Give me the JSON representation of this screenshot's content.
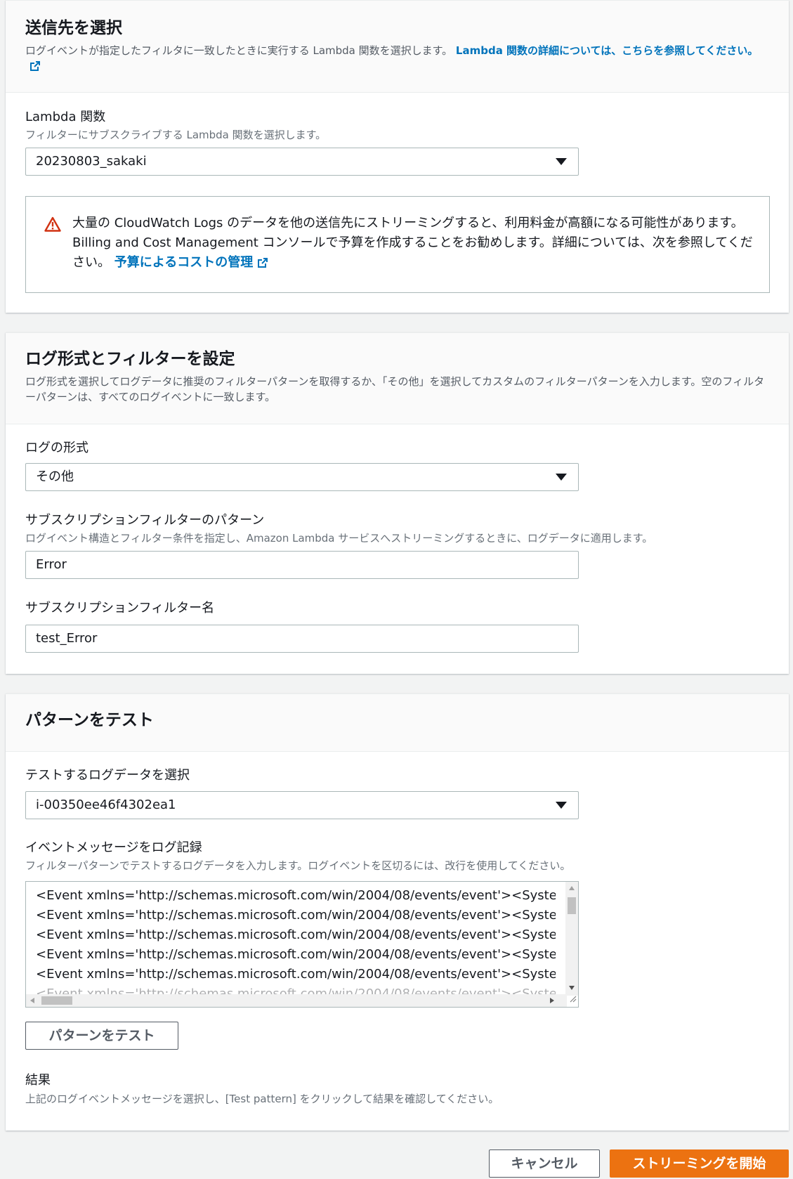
{
  "destination": {
    "title": "送信先を選択",
    "desc": "ログイベントが指定したフィルタに一致したときに実行する Lambda 関数を選択します。",
    "link": "Lambda 関数の詳細については、こちらを参照してください。",
    "lambda_label": "Lambda 関数",
    "lambda_desc": "フィルターにサブスクライブする Lambda 関数を選択します。",
    "lambda_value": "20230803_sakaki",
    "alert_text": "大量の CloudWatch Logs のデータを他の送信先にストリーミングすると、利用料金が高額になる可能性があります。Billing and Cost Management コンソールで予算を作成することをお勧めします。詳細については、次を参照してください。",
    "alert_link": "予算によるコストの管理"
  },
  "filter": {
    "title": "ログ形式とフィルターを設定",
    "desc": "ログ形式を選択してログデータに推奨のフィルターパターンを取得するか、「その他」を選択してカスタムのフィルターパターンを入力します。空のフィルターパターンは、すべてのログイベントに一致します。",
    "format_label": "ログの形式",
    "format_value": "その他",
    "pattern_label": "サブスクリプションフィルターのパターン",
    "pattern_desc": "ログイベント構造とフィルター条件を指定し、Amazon Lambda サービスへストリーミングするときに、ログデータに適用します。",
    "pattern_value": "Error",
    "name_label": "サブスクリプションフィルター名",
    "name_value": "test_Error"
  },
  "test": {
    "title": "パターンをテスト",
    "logdata_label": "テストするログデータを選択",
    "logdata_value": "i-00350ee46f4302ea1",
    "events_label": "イベントメッセージをログ記録",
    "events_desc": "フィルターパターンでテストするログデータを入力します。ログイベントを区切るには、改行を使用してください。",
    "event_lines": [
      "<Event xmlns='http://schemas.microsoft.com/win/2004/08/events/event'><System>",
      "<Event xmlns='http://schemas.microsoft.com/win/2004/08/events/event'><System>",
      "<Event xmlns='http://schemas.microsoft.com/win/2004/08/events/event'><System>",
      "<Event xmlns='http://schemas.microsoft.com/win/2004/08/events/event'><System>",
      "<Event xmlns='http://schemas.microsoft.com/win/2004/08/events/event'><System>",
      "<Event xmlns='http://schemas.microsoft.com/win/2004/08/events/event'><System>"
    ],
    "test_button": "パターンをテスト",
    "result_label": "結果",
    "result_desc": "上記のログイベントメッセージを選択し、[Test pattern] をクリックして結果を確認してください。"
  },
  "footer": {
    "cancel": "キャンセル",
    "start": "ストリーミングを開始"
  },
  "colors": {
    "link": "#0073bb",
    "primary": "#ec7211",
    "warning": "#d13212"
  }
}
